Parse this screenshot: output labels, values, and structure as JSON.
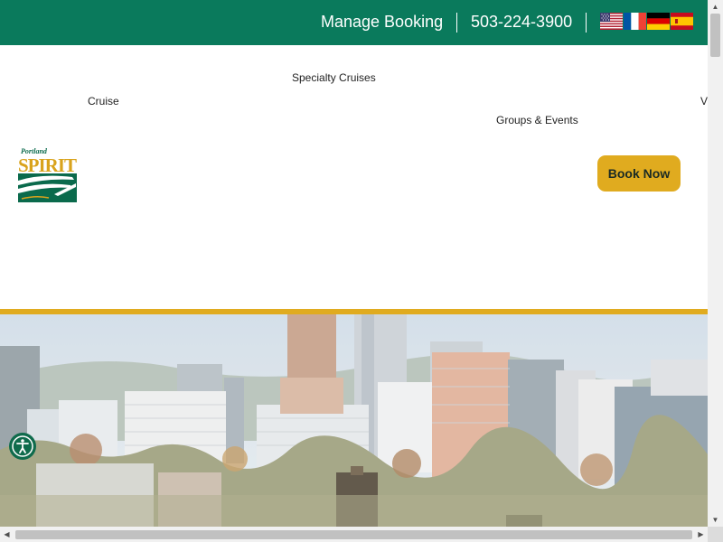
{
  "topbar": {
    "manage_booking": "Manage Booking",
    "phone": "503-224-3900",
    "background": "#0a7a5c",
    "languages": [
      {
        "name": "English",
        "icon": "us-flag-icon"
      },
      {
        "name": "French",
        "icon": "france-flag-icon"
      },
      {
        "name": "German",
        "icon": "germany-flag-icon"
      },
      {
        "name": "Spanish",
        "icon": "spain-flag-icon"
      }
    ]
  },
  "nav": {
    "specialty_cruises": "Specialty Cruises",
    "cruise": "Cruise",
    "groups_events": "Groups & Events",
    "cut_off_item": "V"
  },
  "logo": {
    "top_text": "Portland",
    "main_text": "SPIRIT",
    "icon": "portland-spirit-logo-icon"
  },
  "book_now": "Book Now",
  "colors": {
    "brand_green": "#0a7a5c",
    "accent_gold": "#e0ab1f"
  },
  "hero": {
    "description": "Portland city skyline"
  },
  "accessibility": {
    "icon": "accessibility-icon"
  }
}
